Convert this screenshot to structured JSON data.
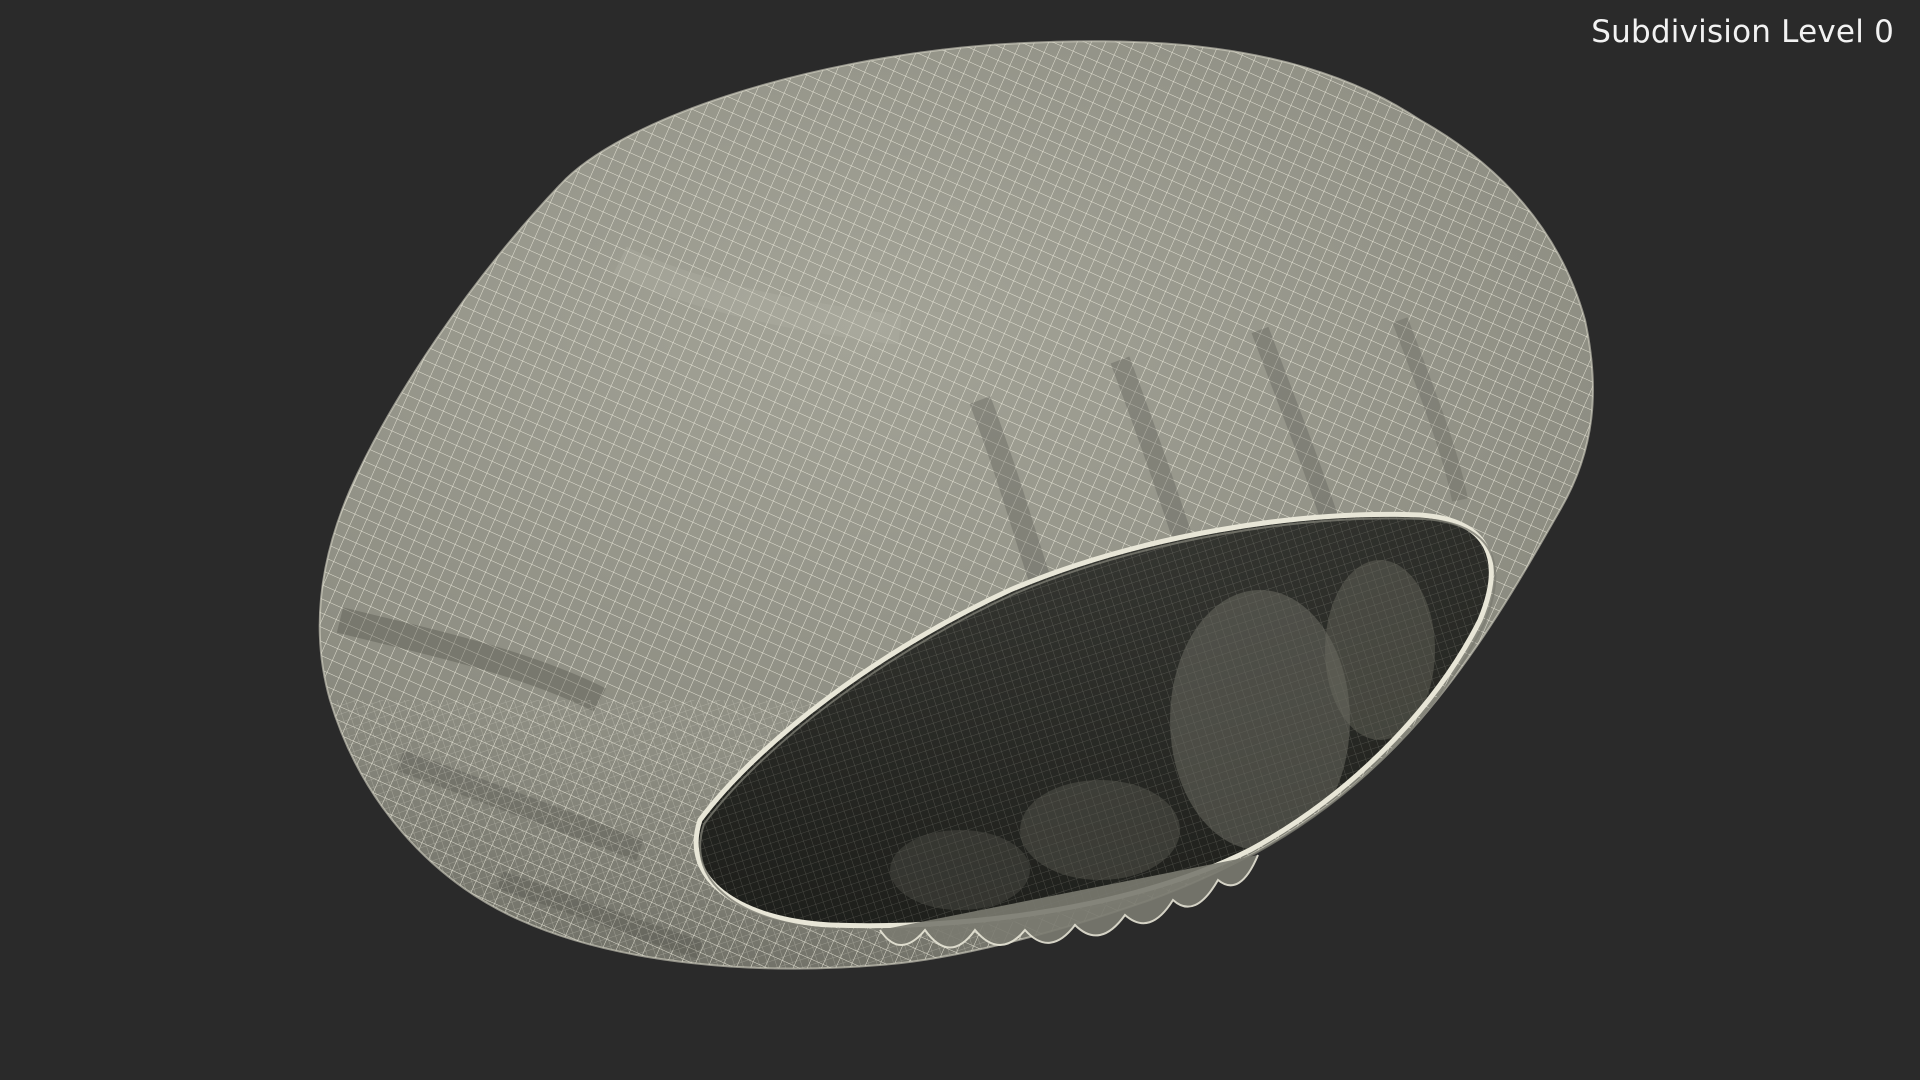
{
  "overlay": {
    "subdivision_label": "Subdivision Level 0"
  },
  "colors": {
    "background": "#2a2a2a",
    "mesh_surface": "#8f8f84",
    "mesh_inner": "#1f201d",
    "wire": "#f1efe1"
  }
}
